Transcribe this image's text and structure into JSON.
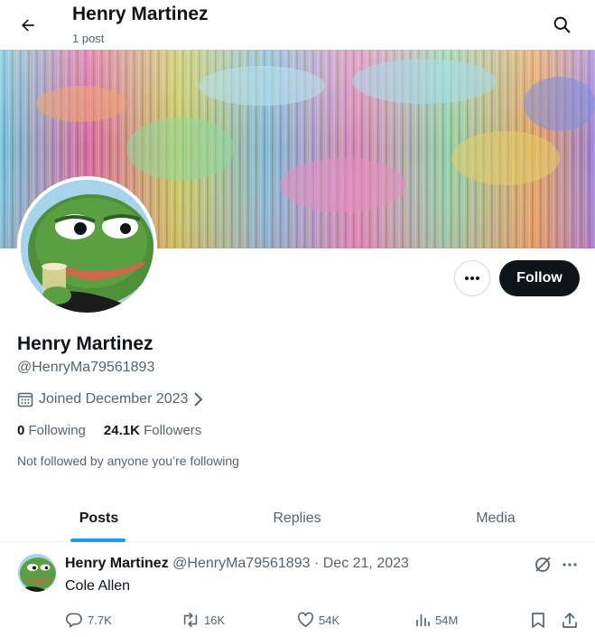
{
  "header": {
    "title": "Henry Martinez",
    "subtitle": "1 post"
  },
  "profile": {
    "display_name": "Henry Martinez",
    "handle": "@HenryMa79561893",
    "joined": "Joined December 2023",
    "following_count": "0",
    "following_label": "Following",
    "followers_count": "24.1K",
    "followers_label": "Followers",
    "not_followed_text": "Not followed by anyone you’re following",
    "follow_label": "Follow"
  },
  "tabs": [
    {
      "label": "Posts",
      "active": true
    },
    {
      "label": "Replies",
      "active": false
    },
    {
      "label": "Media",
      "active": false
    }
  ],
  "tweet": {
    "author": "Henry Martinez",
    "handle": "@HenryMa79561893",
    "separator": "·",
    "date": "Dec 21, 2023",
    "text": "Cole Allen",
    "replies": "7.7K",
    "reposts": "16K",
    "likes": "54K",
    "views": "54M"
  },
  "colors": {
    "accent": "#1d9bf0",
    "text_primary": "#0f1419",
    "text_secondary": "#536471",
    "follow_bg": "#0f1419"
  },
  "icons": {
    "back": "arrow-left-icon",
    "search": "search-icon",
    "more": "more-dots-icon",
    "calendar": "calendar-icon",
    "chevron": "chevron-right-icon",
    "grok": "grok-icon",
    "reply": "reply-icon",
    "repost": "repost-icon",
    "like": "heart-icon",
    "views": "bar-chart-icon",
    "bookmark": "bookmark-icon",
    "share": "share-icon"
  }
}
